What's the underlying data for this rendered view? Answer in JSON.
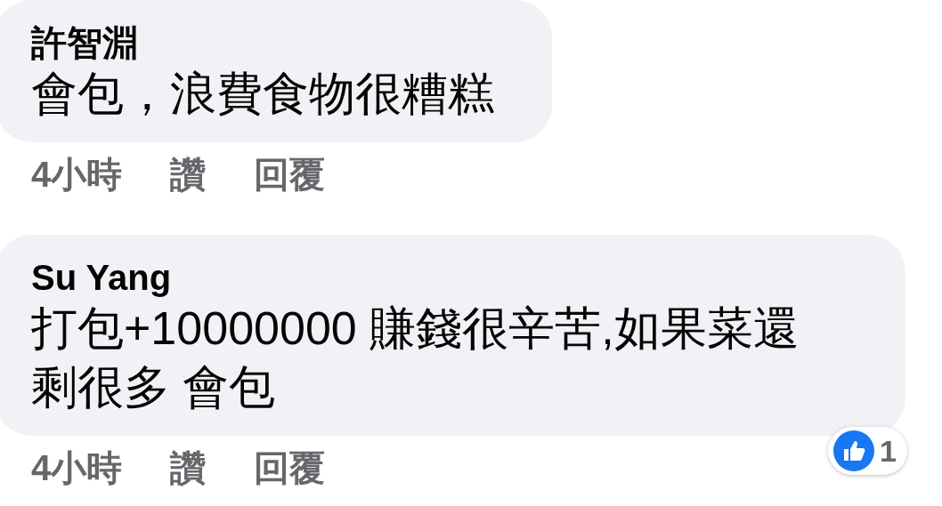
{
  "comments": [
    {
      "author": "許智淵",
      "text": "會包，浪費食物很糟糕",
      "time": "4小時",
      "like": "讚",
      "reply": "回覆"
    },
    {
      "author": "Su Yang",
      "text": "打包+10000000 賺錢很辛苦,如果菜還剩很多 會包",
      "time": "4小時",
      "like": "讚",
      "reply": "回覆",
      "reactions": {
        "count": "1"
      }
    }
  ]
}
